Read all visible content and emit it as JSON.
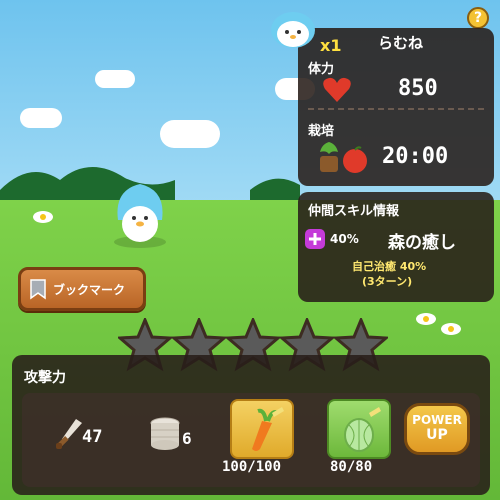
{
  "character": {
    "name": "らむね",
    "multiplier": "x1",
    "stats": {
      "hp_label": "体力",
      "hp_value": "850",
      "cultivation_label": "栽培",
      "cultivation_time": "20:00"
    }
  },
  "skill": {
    "header": "仲間スキル情報",
    "chance": "40%",
    "name": "森の癒し",
    "effect": "自己治癒 40%",
    "duration": "(3ターン)"
  },
  "bookmark": {
    "label": "ブックマーク"
  },
  "stars": {
    "filled": 0,
    "total": 5
  },
  "attack": {
    "label": "攻撃力",
    "weapon_value": "47",
    "coins_value": "6",
    "carrot_progress": "100/100",
    "melon_progress": "80/80",
    "power_up_line1": "POWER",
    "power_up_line2": "UP"
  },
  "help": {
    "label": "?"
  },
  "colors": {
    "panel": "#2a1f1a",
    "accent_red": "#e03a2a",
    "skill_purple": "#c43bd8",
    "skill_green": "#ffe870"
  }
}
